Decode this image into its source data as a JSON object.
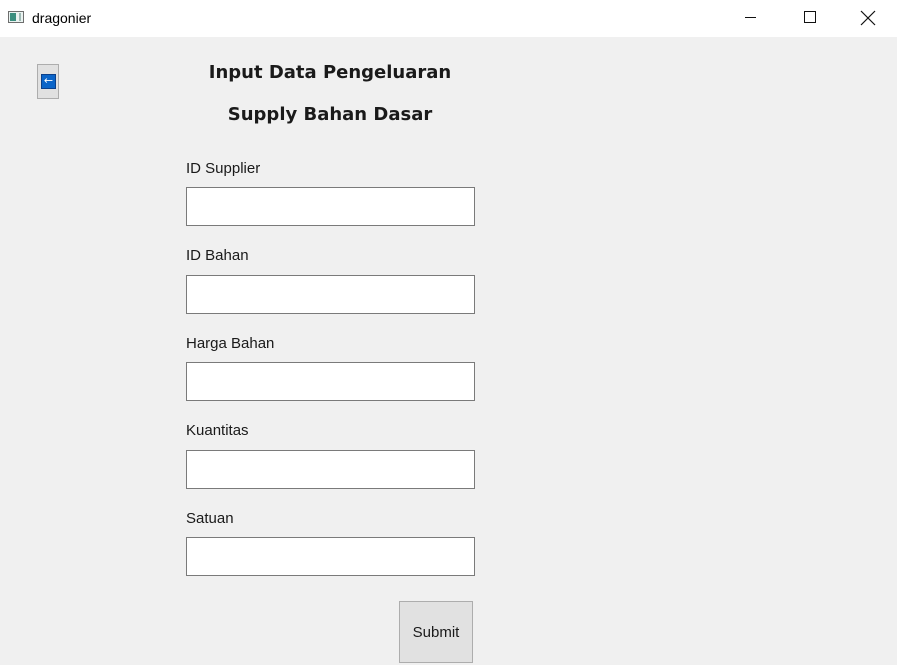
{
  "window": {
    "title": "dragonier"
  },
  "back_button": {
    "icon": "left-arrow-icon",
    "glyph": "←"
  },
  "header": {
    "title": "Input Data Pengeluaran",
    "subtitle": "Supply Bahan Dasar"
  },
  "form": {
    "fields": [
      {
        "label": "ID Supplier",
        "value": ""
      },
      {
        "label": "ID Bahan",
        "value": ""
      },
      {
        "label": "Harga Bahan",
        "value": ""
      },
      {
        "label": "Kuantitas",
        "value": ""
      },
      {
        "label": "Satuan",
        "value": ""
      }
    ],
    "submit_label": "Submit"
  },
  "colors": {
    "background": "#f0f0f0",
    "titlebar": "#ffffff",
    "back_arrow_accent": "#0a64c8",
    "button_face": "#e1e1e1"
  }
}
